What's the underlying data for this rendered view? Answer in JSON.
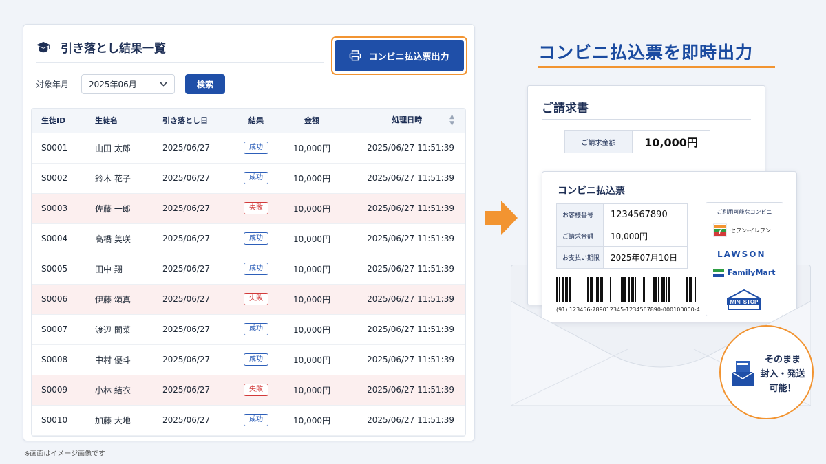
{
  "panel": {
    "title": "引き落とし結果一覧",
    "print_button": "コンビニ払込票出力",
    "filter_label": "対象年月",
    "month_value": "2025年06月",
    "search_button": "検索"
  },
  "table": {
    "headers": [
      "生徒ID",
      "生徒名",
      "引き落とし日",
      "結果",
      "金額",
      "処理日時"
    ],
    "rows": [
      {
        "id": "S0001",
        "name": "山田 太郎",
        "date": "2025/06/27",
        "result": "成功",
        "status": "ok",
        "amount": "10,000円",
        "ts": "2025/06/27 11:51:39"
      },
      {
        "id": "S0002",
        "name": "鈴木 花子",
        "date": "2025/06/27",
        "result": "成功",
        "status": "ok",
        "amount": "10,000円",
        "ts": "2025/06/27 11:51:39"
      },
      {
        "id": "S0003",
        "name": "佐藤 一郎",
        "date": "2025/06/27",
        "result": "失敗",
        "status": "ng",
        "amount": "10,000円",
        "ts": "2025/06/27 11:51:39"
      },
      {
        "id": "S0004",
        "name": "高橋 美咲",
        "date": "2025/06/27",
        "result": "成功",
        "status": "ok",
        "amount": "10,000円",
        "ts": "2025/06/27 11:51:39"
      },
      {
        "id": "S0005",
        "name": "田中 翔",
        "date": "2025/06/27",
        "result": "成功",
        "status": "ok",
        "amount": "10,000円",
        "ts": "2025/06/27 11:51:39"
      },
      {
        "id": "S0006",
        "name": "伊藤 頌真",
        "date": "2025/06/27",
        "result": "失敗",
        "status": "ng",
        "amount": "10,000円",
        "ts": "2025/06/27 11:51:39"
      },
      {
        "id": "S0007",
        "name": "渡辺 開菜",
        "date": "2025/06/27",
        "result": "成功",
        "status": "ok",
        "amount": "10,000円",
        "ts": "2025/06/27 11:51:39"
      },
      {
        "id": "S0008",
        "name": "中村 優斗",
        "date": "2025/06/27",
        "result": "成功",
        "status": "ok",
        "amount": "10,000円",
        "ts": "2025/06/27 11:51:39"
      },
      {
        "id": "S0009",
        "name": "小林 結衣",
        "date": "2025/06/27",
        "result": "失敗",
        "status": "ng",
        "amount": "10,000円",
        "ts": "2025/06/27 11:51:39"
      },
      {
        "id": "S0010",
        "name": "加藤 大地",
        "date": "2025/06/27",
        "result": "成功",
        "status": "ok",
        "amount": "10,000円",
        "ts": "2025/06/27 11:51:39"
      }
    ]
  },
  "note": "※画面はイメージ画像です",
  "headline": "コンビニ払込票を即時出力",
  "invoice": {
    "title": "ご請求書",
    "amount_label": "ご請求金額",
    "amount_value": "10,000円"
  },
  "slip": {
    "title": "コンビニ払込票",
    "customer_label": "お客様番号",
    "customer_value": "1234567890",
    "amount_label": "ご請求金額",
    "amount_value": "10,000円",
    "due_label": "お支払い期限",
    "due_value": "2025年07月10日",
    "barcode_number": "(91) 123456-789012345-1234567890-000100000-4",
    "stores_title": "ご利用可能なコンビニ",
    "stores": [
      "セブン-イレブン",
      "LAWSON",
      "FamilyMart",
      "MINI STOP"
    ]
  },
  "callout": {
    "line1": "そのまま",
    "line2": "封入・発送",
    "line3": "可能！"
  },
  "colors": {
    "primary": "#1f4fa8",
    "accent": "#f29431",
    "fail_row": "#fcefef",
    "fail_badge": "#d23a3a"
  },
  "icons": [
    "graduation-cap-icon",
    "printer-icon",
    "chevron-down-icon",
    "sort-icon",
    "arrow-right-icon",
    "package-icon"
  ]
}
